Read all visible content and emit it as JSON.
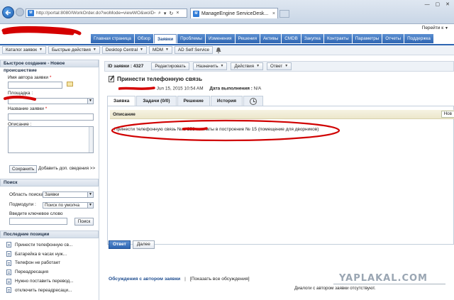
{
  "browser": {
    "url": "http://portal:8080/WorkOrder.do?woMode=viewWO&woID=4327",
    "tab_title": "ManageEngine ServiceDesk...",
    "tab_close": "×",
    "fav_label": "M",
    "go_icon": "search-icon",
    "refresh_icon": "refresh-icon"
  },
  "header": {
    "user_menu": "Перейти к"
  },
  "main_tabs": [
    "Главная страница",
    "Обзор",
    "Заявки",
    "Проблемы",
    "Изменения",
    "Решения",
    "Активы",
    "CMDB",
    "Закупка",
    "Контракты",
    "Параметры",
    "Отчеты",
    "Поддержка"
  ],
  "active_main_tab": "Заявки",
  "toolbar": {
    "catalog": "Каталог заявок",
    "quick_actions": "Быстрые действия",
    "desktop_central": "Desktop Central",
    "mdm": "MDM",
    "ad_self_service": "AD Self Service"
  },
  "quick_create": {
    "title": "Быстрое создание - Новое происшествие",
    "requester_label": "Имя автора заявки",
    "site_label": "Площадка :",
    "subject_label": "Название заявки",
    "description_label": "Описание :",
    "save_button": "Сохранить",
    "add_info": "Добавить доп. сведения >>",
    "required_mark": "*"
  },
  "search": {
    "title": "Поиск",
    "scope_label": "Область поиска:",
    "scope_value": "Заявки",
    "submodule_label": "Подмодули :",
    "submodule_value": "Поиск по умолча",
    "keyword_label": "Введите ключевое слово",
    "find_button": "Поиск"
  },
  "recent": {
    "title": "Последние позиции",
    "items": [
      "Принести телефонную св...",
      "Батарейка в часах нуж...",
      "Телефон не работает",
      "Переадресация",
      "Нужно поставить перевод...",
      "отключить переадресаци..."
    ]
  },
  "request": {
    "id_label": "ID заявки : 4327",
    "edit_button": "Редактировать",
    "assign_button": "Назначить",
    "actions_button": "Действия",
    "reply_button": "Ответ",
    "title": "Принести телефонную связь",
    "created": "Jun 15, 2015 10:54 AM",
    "due_label": "Дата выполнения :",
    "due_value": "N/A",
    "tabs": [
      "Заявка",
      "Задачи (0/0)",
      "Решение",
      "История"
    ],
    "description_head": "Описание",
    "new_button": "Нов",
    "description_text": "Принести телефонную связь №            с 253 комнаты в построение № 15 (помещение для дворников)",
    "reply_action": "Ответ",
    "next_action": "Далее"
  },
  "discussion": {
    "link": "Обсуждения с автором заявки",
    "separator": "|",
    "show_all": "[Показать все обсуждения]",
    "empty": "Диалоги с автором заявки отсутствуют."
  },
  "watermark": "YAPLAKAL.COM",
  "colors": {
    "accent": "#2e65b2",
    "annotation": "#d00000"
  }
}
